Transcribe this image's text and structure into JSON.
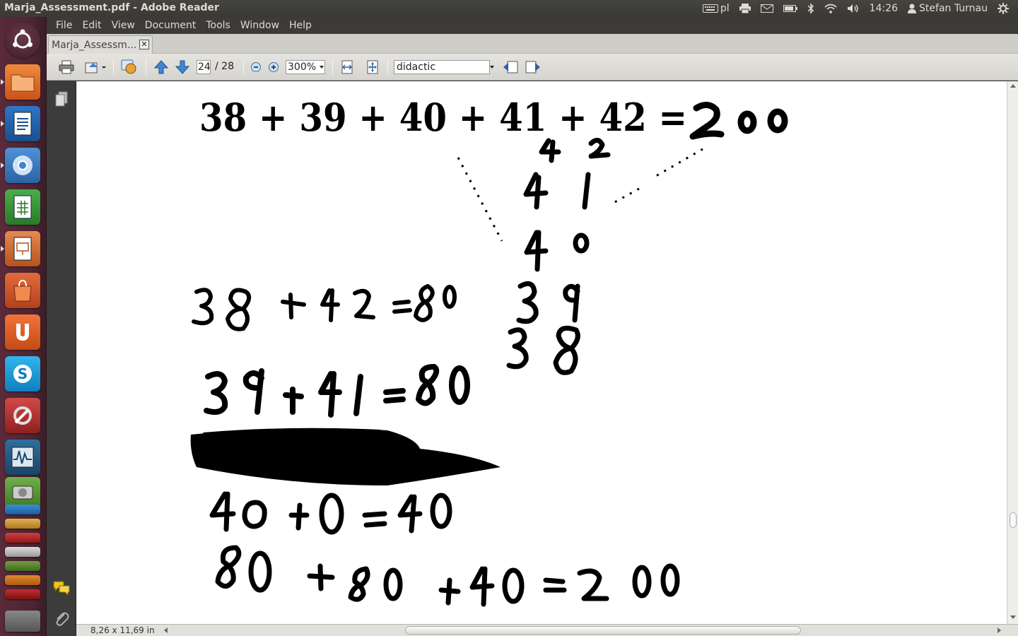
{
  "window": {
    "title": "Marja_Assessment.pdf - Adobe Reader"
  },
  "top_panel": {
    "keyboard_layout": "pl",
    "clock": "14:26",
    "user": "Stefan Turnau",
    "icons": [
      "keyboard-icon",
      "printer-icon",
      "mail-icon",
      "battery-icon",
      "bluetooth-icon",
      "wifi-icon",
      "volume-icon",
      "user-icon",
      "gear-icon"
    ]
  },
  "launcher": {
    "items": [
      "ubuntu-home",
      "files",
      "writer",
      "chromium",
      "calc",
      "impress",
      "software-center",
      "ubuntu-one",
      "skype",
      "system-settings",
      "system-monitor",
      "disk-utility"
    ],
    "colors": {
      "base": "#4d2533",
      "accent": "#dd4814"
    }
  },
  "menubar": {
    "items": [
      "File",
      "Edit",
      "View",
      "Document",
      "Tools",
      "Window",
      "Help"
    ]
  },
  "tab": {
    "label": "Marja_Assessm...",
    "close": "✕"
  },
  "toolbar": {
    "current_page": "24",
    "total_pages": "/ 28",
    "zoom": "300%",
    "search_value": "didactic"
  },
  "status": {
    "page_size": "8,26 x 11,69 in"
  },
  "document": {
    "typed_equation": "38 + 39 + 40 + 41 + 42 =",
    "handwritten_lines": [
      "2 00",
      "4 2",
      "4 1",
      "4 0",
      "3 9",
      "3 8",
      "38 + 42 = 80",
      "39 + 41 = 80",
      "40 + 0 = 40",
      "80 + 80 + 40 = 200"
    ]
  }
}
